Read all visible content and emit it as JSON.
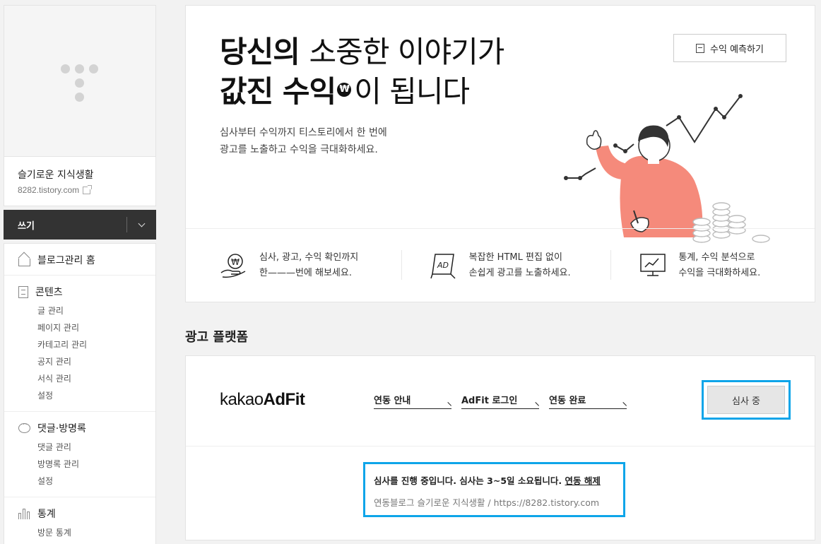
{
  "sidebar": {
    "blog_name": "슬기로운 지식생활",
    "blog_url": "8282.tistory.com",
    "write_label": "쓰기",
    "menu": [
      {
        "label": "블로그관리 홈",
        "icon": "home-icon",
        "items": []
      },
      {
        "label": "콘텐츠",
        "icon": "document-icon",
        "items": [
          "글 관리",
          "페이지 관리",
          "카테고리 관리",
          "공지 관리",
          "서식 관리",
          "설정"
        ]
      },
      {
        "label": "댓글·방명록",
        "icon": "comment-icon",
        "items": [
          "댓글 관리",
          "방명록 관리",
          "설정"
        ]
      },
      {
        "label": "통계",
        "icon": "stats-icon",
        "items": [
          "방문 통계"
        ]
      }
    ]
  },
  "hero": {
    "title_line1_bold": "당신의",
    "title_line1_light": "소중한 이야기가",
    "title_line2_bold": "값진 수익",
    "won_symbol": "₩",
    "title_line2_light": "이 됩니다",
    "desc_line1": "심사부터 수익까지 티스토리에서 한 번에",
    "desc_line2": "광고를 노출하고 수익을 극대화하세요.",
    "predict_button": "수익 예측하기",
    "features": [
      {
        "icon": "won-hand-icon",
        "line1": "심사, 광고, 수익 확인까지",
        "line2": "한———번에 해보세요."
      },
      {
        "icon": "ad-board-icon",
        "line1": "복잡한 HTML 편집 없이",
        "line2": "손쉽게 광고를 노출하세요."
      },
      {
        "icon": "monitor-chart-icon",
        "line1": "통계, 수익 분석으로",
        "line2": "수익을 극대화하세요."
      }
    ]
  },
  "platform": {
    "section_title": "광고 플랫폼",
    "logo_prefix": "kakao",
    "logo_bold": "AdFit",
    "steps": [
      "연동 안내",
      "AdFit 로그인",
      "연동 완료"
    ],
    "review_button": "심사 중",
    "notice_text": "심사를 진행 중입니다. 심사는 3~5일 소요됩니다.",
    "notice_link": "연동 해제",
    "notice_sub": "연동블로그 슬기로운 지식생활 / https://8282.tistory.com"
  },
  "colors": {
    "highlight": "#0ea5e9",
    "write_bg": "#333333",
    "accent_salmon": "#f58a7b"
  }
}
